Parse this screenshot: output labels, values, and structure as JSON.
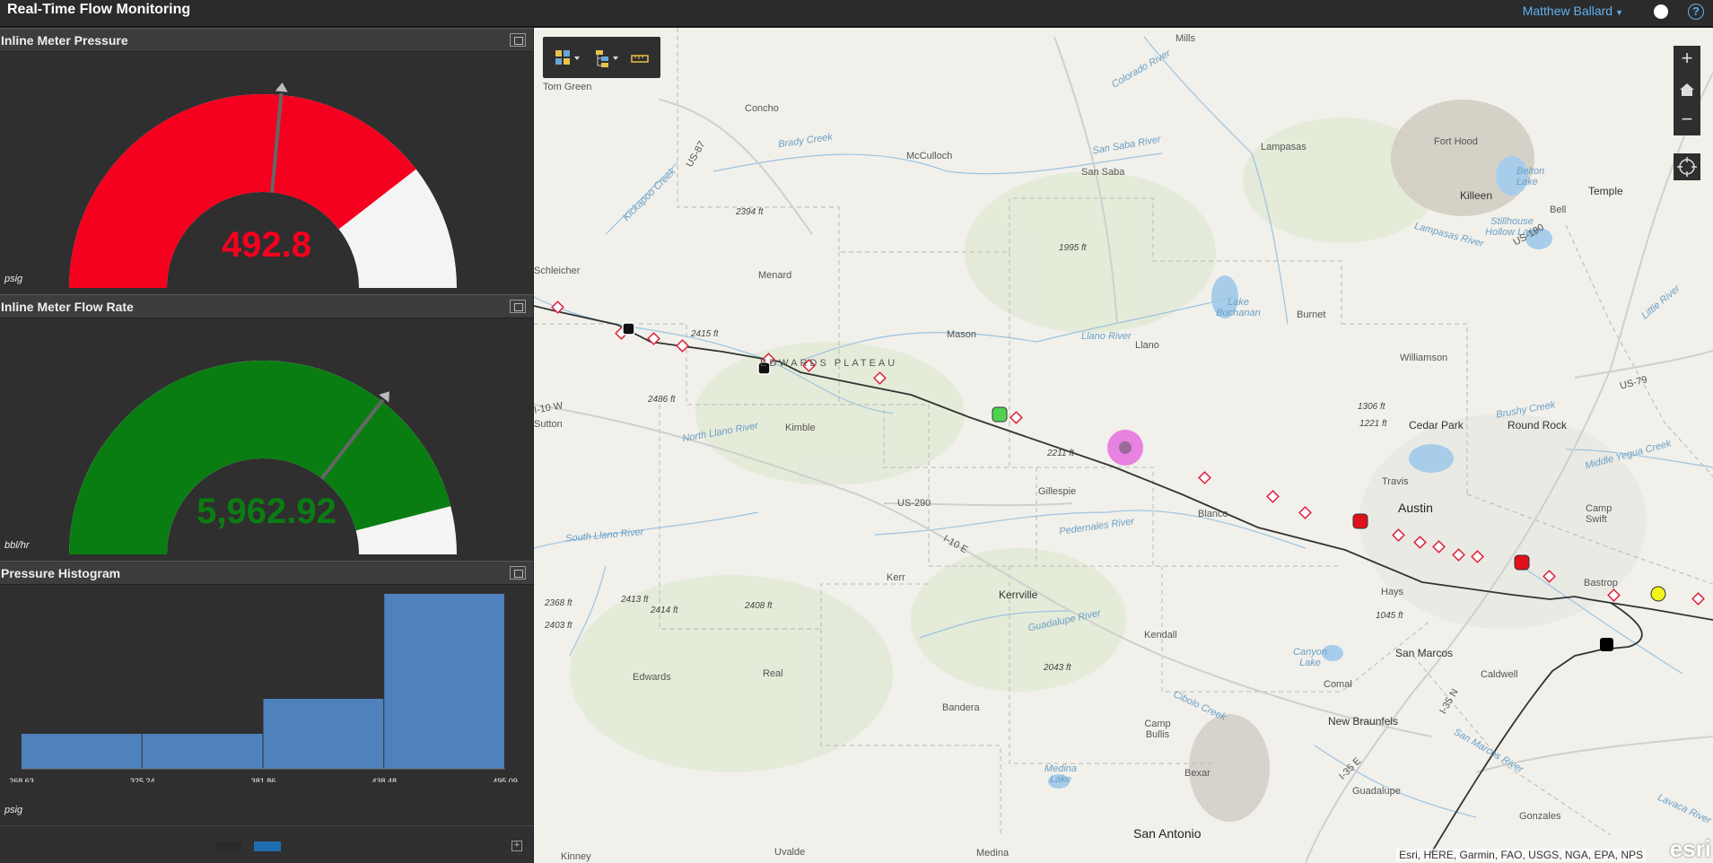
{
  "app": {
    "title": "Real-Time Flow Monitoring",
    "user_name": "Matthew Ballard",
    "help_label": "?"
  },
  "pressure_gauge": {
    "title": "Inline Meter Pressure",
    "value": 492.8,
    "value_text": "492.8",
    "unit": "psig",
    "threshold_fraction": 0.79,
    "fill_fraction": 0.79,
    "color": "#f5001e",
    "background_color": "#f4f4f4",
    "needle_fraction": 0.53
  },
  "flow_gauge": {
    "title": "Inline Meter Flow Rate",
    "value": 5962.92,
    "value_text": "5,962.92",
    "unit": "bbl/hr",
    "fill_fraction": 0.92,
    "color": "#0a7d12",
    "background_color": "#f4f4f4",
    "needle_fraction": 0.71
  },
  "histogram": {
    "title": "Pressure Histogram",
    "unit": "psig",
    "add_label": "+",
    "legend": [
      {
        "color": "#2b2b2b"
      },
      {
        "color": "#1f6fb0"
      }
    ]
  },
  "chart_data": {
    "type": "bar",
    "categories": [
      "268.63",
      "325.24",
      "381.86",
      "438.48",
      "495.09"
    ],
    "bin_edges": [
      268.63,
      325.24,
      381.86,
      438.48,
      495.09
    ],
    "values": [
      1,
      1,
      2,
      5
    ],
    "ylim": [
      0,
      5
    ],
    "color": "#4f81bd",
    "grid": false
  },
  "map": {
    "attribution": "Esri, HERE, Garmin, FAO, USGS, NGA, EPA, NPS",
    "logo_text": "esri",
    "zoom_in": "+",
    "zoom_out": "−",
    "labels": [
      {
        "text": "Mills"
      },
      {
        "text": "Tom Green"
      },
      {
        "text": "Concho"
      },
      {
        "text": "McCulloch"
      },
      {
        "text": "San Saba"
      },
      {
        "text": "Lampasas"
      },
      {
        "text": "Fort Hood"
      },
      {
        "text": "Killeen"
      },
      {
        "text": "Temple"
      },
      {
        "text": "Bell"
      },
      {
        "text": "Belton Lake"
      },
      {
        "text": "Stillhouse Hollow Lake"
      },
      {
        "text": "Menard"
      },
      {
        "text": "Mason"
      },
      {
        "text": "Llano"
      },
      {
        "text": "Burnet"
      },
      {
        "text": "Lake Buchanan"
      },
      {
        "text": "Williamson"
      },
      {
        "text": "Cedar Park"
      },
      {
        "text": "Round Rock"
      },
      {
        "text": "EDWARDS PLATEAU"
      },
      {
        "text": "Kimble"
      },
      {
        "text": "Gillespie"
      },
      {
        "text": "Blanco"
      },
      {
        "text": "Travis"
      },
      {
        "text": "Austin"
      },
      {
        "text": "Camp Swift"
      },
      {
        "text": "Bastrop"
      },
      {
        "text": "Kerr"
      },
      {
        "text": "Kerrville"
      },
      {
        "text": "Kendall"
      },
      {
        "text": "Hays"
      },
      {
        "text": "San Marcos"
      },
      {
        "text": "Caldwell"
      },
      {
        "text": "Edwards"
      },
      {
        "text": "Real"
      },
      {
        "text": "Bandera"
      },
      {
        "text": "Comal"
      },
      {
        "text": "Canyon Lake"
      },
      {
        "text": "New Braunfels"
      },
      {
        "text": "Camp Bullis"
      },
      {
        "text": "Medina Lake"
      },
      {
        "text": "Bexar"
      },
      {
        "text": "Guadalupe"
      },
      {
        "text": "Gonzales"
      },
      {
        "text": "San Antonio"
      },
      {
        "text": "Uvalde"
      },
      {
        "text": "Kinney"
      },
      {
        "text": "Medina"
      },
      {
        "text": "Schleicher"
      },
      {
        "text": "Sutton"
      },
      {
        "text": "2394 ft"
      },
      {
        "text": "1995 ft"
      },
      {
        "text": "2415 ft"
      },
      {
        "text": "2486 ft"
      },
      {
        "text": "2211 ft"
      },
      {
        "text": "1306 ft"
      },
      {
        "text": "1221 ft"
      },
      {
        "text": "2368 ft"
      },
      {
        "text": "2413 ft"
      },
      {
        "text": "2414 ft"
      },
      {
        "text": "2403 ft"
      },
      {
        "text": "2408 ft"
      },
      {
        "text": "2043 ft"
      },
      {
        "text": "1045 ft"
      },
      {
        "text": "Llano River"
      },
      {
        "text": "North Llano River"
      },
      {
        "text": "South Llano River"
      },
      {
        "text": "Pedernales River"
      },
      {
        "text": "Guadalupe River"
      },
      {
        "text": "Brady Creek"
      },
      {
        "text": "San Saba River"
      },
      {
        "text": "Colorado River"
      },
      {
        "text": "Kickapoo Creek"
      },
      {
        "text": "Lampasas River"
      },
      {
        "text": "Brushy Creek"
      },
      {
        "text": "Middle Yegua Creek"
      },
      {
        "text": "Cibolo Creek"
      },
      {
        "text": "San Marcos River"
      },
      {
        "text": "Lavaca River"
      },
      {
        "text": "US-87"
      },
      {
        "text": "US-190"
      },
      {
        "text": "US-290"
      },
      {
        "text": "I-10 E"
      },
      {
        "text": "I-10 W"
      },
      {
        "text": "I-35 N"
      },
      {
        "text": "I-35 E"
      },
      {
        "text": "US-79"
      },
      {
        "text": "Little River"
      }
    ]
  }
}
